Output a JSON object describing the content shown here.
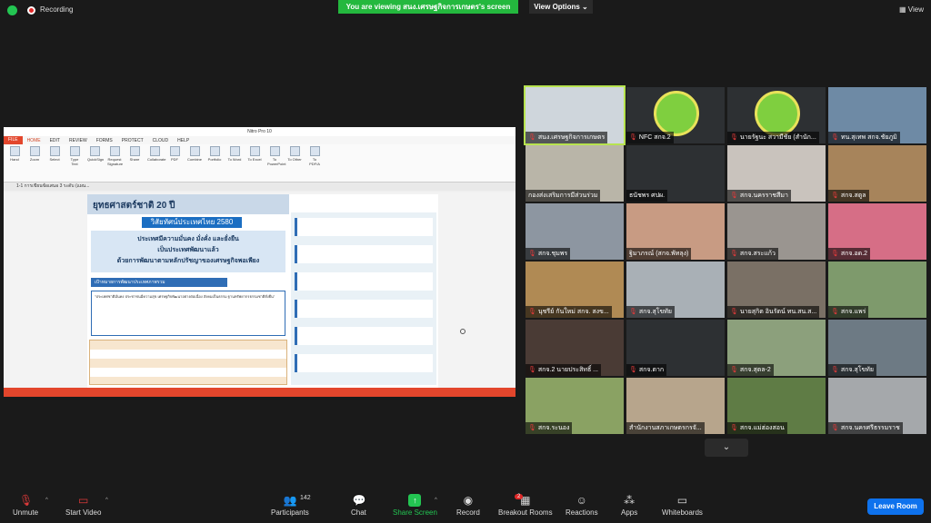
{
  "top": {
    "recording": "Recording",
    "viewing": "You are viewing สนง.เศรษฐกิจการเกษตร's screen",
    "view_options": "View Options ⌄",
    "view": "View"
  },
  "share": {
    "window_title": "Nitro Pro 10",
    "tabs": [
      "FILE",
      "HOME",
      "EDIT",
      "REVIEW",
      "FORMS",
      "PROTECT",
      "CLOUD",
      "HELP"
    ],
    "ribbon": [
      "Hand",
      "Zoom",
      "Select",
      "Type Text",
      "QuickSign",
      "Request Signature",
      "Share",
      "Collaborate",
      "PDF",
      "Combine",
      "Portfolio",
      "To Word",
      "To Excel",
      "To PowerPoint",
      "To Other",
      "To PDF/A"
    ],
    "doc_tab": "1-1 การเขียนข้อเสนอ 3 ระดับ (แผน...",
    "pdf_title": "ยุทธศาสตร์ชาติ 20 ปี",
    "pdf_year": "วิสัยทัศน์ประเทศไทย 2580",
    "pdf_vision": [
      "ประเทศมีความมั่นคง มั่งคั่ง และยั่งยืน",
      "เป็นประเทศพัฒนาแล้ว",
      "ด้วยการพัฒนาตามหลักปรัชญาของเศรษฐกิจพอเพียง"
    ],
    "pdf_bar": "เป้าหมายการพัฒนาประเทศภาพรวม",
    "pdf_quote": "\"ประเทศชาติมั่นคง ประชาชนมีความสุข เศรษฐกิจพัฒนาอย่างต่อเนื่อง สังคมเป็นธรรม ฐานทรัพยากรธรรมชาติยั่งยืน\""
  },
  "participants": [
    {
      "name": "สนง.เศรษฐกิจการเกษตร",
      "muted": true,
      "active": true,
      "color": "#cfd6dc"
    },
    {
      "name": "NFC สกจ.2",
      "muted": true,
      "emblem": true,
      "color": "#2d3033"
    },
    {
      "name": "นายรัฐนะ สวามีชัย (สำนัก...",
      "muted": true,
      "emblem": true,
      "color": "#2d3033"
    },
    {
      "name": "ทน.สุเทพ สกจ.ชัยภูมิ",
      "muted": true,
      "color": "#6e8aa5"
    },
    {
      "name": "กองส่งเสริมการมีส่วนร่วม",
      "muted": false,
      "color": "#b9b5a8"
    },
    {
      "name": "ธนัชพร ศปผ.",
      "muted": false,
      "color": "#2d3033"
    },
    {
      "name": "สกจ.นครราชสีมา",
      "muted": true,
      "color": "#c9c3bd"
    },
    {
      "name": "สกจ.สตูล",
      "muted": true,
      "color": "#a7845b"
    },
    {
      "name": "สกจ.ชุมพร",
      "muted": true,
      "color": "#8d96a1"
    },
    {
      "name": "ฐิมาภรณ์ (สกจ.พัทลุง)",
      "muted": false,
      "color": "#c89b83"
    },
    {
      "name": "สกจ.สระแก้ว",
      "muted": true,
      "color": "#9a9590"
    },
    {
      "name": "สกจ.อด.2",
      "muted": true,
      "color": "#d66e86"
    },
    {
      "name": "นุชรีย์ กันใหม่ สกจ. สงข...",
      "muted": true,
      "color": "#b08a54"
    },
    {
      "name": "สกจ.สุโขทัย",
      "muted": true,
      "color": "#a9b0b6"
    },
    {
      "name": "นายสุกิต อินรัตน์ ทน.สน.ส...",
      "muted": true,
      "color": "#7a7065"
    },
    {
      "name": "สกจ.แพร่",
      "muted": true,
      "color": "#7e9a6c"
    },
    {
      "name": "สกจ.2 นายประสิทธิ์ ...",
      "muted": true,
      "color": "#4a3b35"
    },
    {
      "name": "สกจ.ตาก",
      "muted": true,
      "color": "#2d3033"
    },
    {
      "name": "สกจ.สุตล-2",
      "muted": true,
      "color": "#8ca07c"
    },
    {
      "name": "สกจ.สุโขทัย",
      "muted": true,
      "color": "#6d7a84"
    },
    {
      "name": "สกจ.ระนอง",
      "muted": true,
      "color": "#8aa263"
    },
    {
      "name": "สำนักงานสภาเกษตรกรจั...",
      "muted": false,
      "color": "#b7a58c"
    },
    {
      "name": "สกจ.แม่ฮ่องสอน",
      "muted": true,
      "color": "#5f7c45"
    },
    {
      "name": "สกจ.นครศรีธรรมราช",
      "muted": true,
      "color": "#a5a8ab"
    }
  ],
  "toolbar": {
    "unmute": "Unmute",
    "start_video": "Start Video",
    "participants": "Participants",
    "participants_count": "142",
    "chat": "Chat",
    "share_screen": "Share Screen",
    "record": "Record",
    "breakout": "Breakout Rooms",
    "breakout_badge": "2",
    "reactions": "Reactions",
    "apps": "Apps",
    "whiteboards": "Whiteboards",
    "leave": "Leave Room"
  }
}
